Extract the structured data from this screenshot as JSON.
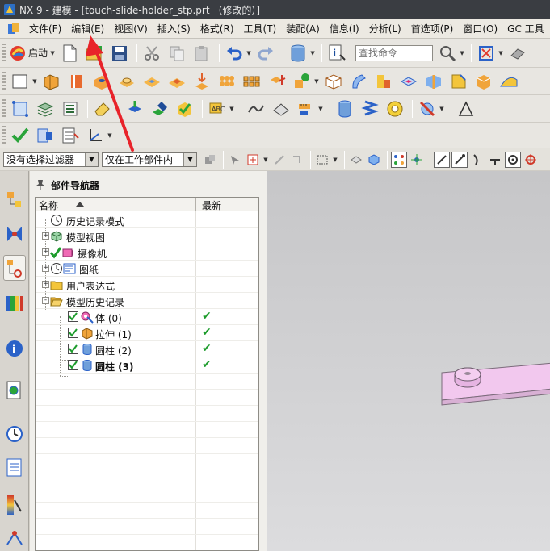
{
  "window": {
    "title": "NX 9 - 建模 - [touch-slide-holder_stp.prt （修改的）]"
  },
  "menubar": {
    "items": [
      {
        "label": "文件(F)"
      },
      {
        "label": "编辑(E)"
      },
      {
        "label": "视图(V)"
      },
      {
        "label": "插入(S)"
      },
      {
        "label": "格式(R)"
      },
      {
        "label": "工具(T)"
      },
      {
        "label": "装配(A)"
      },
      {
        "label": "信息(I)"
      },
      {
        "label": "分析(L)"
      },
      {
        "label": "首选项(P)"
      },
      {
        "label": "窗口(O)"
      },
      {
        "label": "GC 工具"
      }
    ]
  },
  "toolbar": {
    "start_label": "启动",
    "search_placeholder": "查找命令"
  },
  "selection_bar": {
    "filter_value": "没有选择过滤器",
    "scope_value": "仅在工作部件内"
  },
  "part_navigator": {
    "title": "部件导航器",
    "columns": [
      "名称",
      "最新"
    ],
    "rows": [
      {
        "label": "历史记录模式",
        "icon": "clock-icon",
        "expander": "",
        "checked": false,
        "latest": ""
      },
      {
        "label": "模型视图",
        "icon": "model-views-icon",
        "expander": "+",
        "checked": false,
        "latest": ""
      },
      {
        "label": "摄像机",
        "icon": "camera-icon",
        "expander": "+",
        "checked": false,
        "latest": ""
      },
      {
        "label": "图纸",
        "icon": "drawing-icon",
        "expander": "+",
        "checked": false,
        "latest": ""
      },
      {
        "label": "用户表达式",
        "icon": "folder-icon",
        "expander": "+",
        "checked": false,
        "latest": ""
      },
      {
        "label": "模型历史记录",
        "icon": "folder-open-icon",
        "expander": "-",
        "checked": false,
        "latest": ""
      },
      {
        "label": "体 (0)",
        "icon": "body-icon",
        "expander": "",
        "checked": true,
        "latest": "✔"
      },
      {
        "label": "拉伸 (1)",
        "icon": "extrude-icon",
        "expander": "",
        "checked": true,
        "latest": "✔"
      },
      {
        "label": "圆柱 (2)",
        "icon": "cylinder-icon",
        "expander": "",
        "checked": true,
        "latest": "✔"
      },
      {
        "label": "圆柱 (3)",
        "icon": "cylinder-icon",
        "expander": "",
        "checked": true,
        "latest": "✔"
      }
    ]
  },
  "colors": {
    "accent_check": "#1d9c2c",
    "part_fill": "#f2c8ee",
    "annotation_arrow": "#e8232a"
  }
}
